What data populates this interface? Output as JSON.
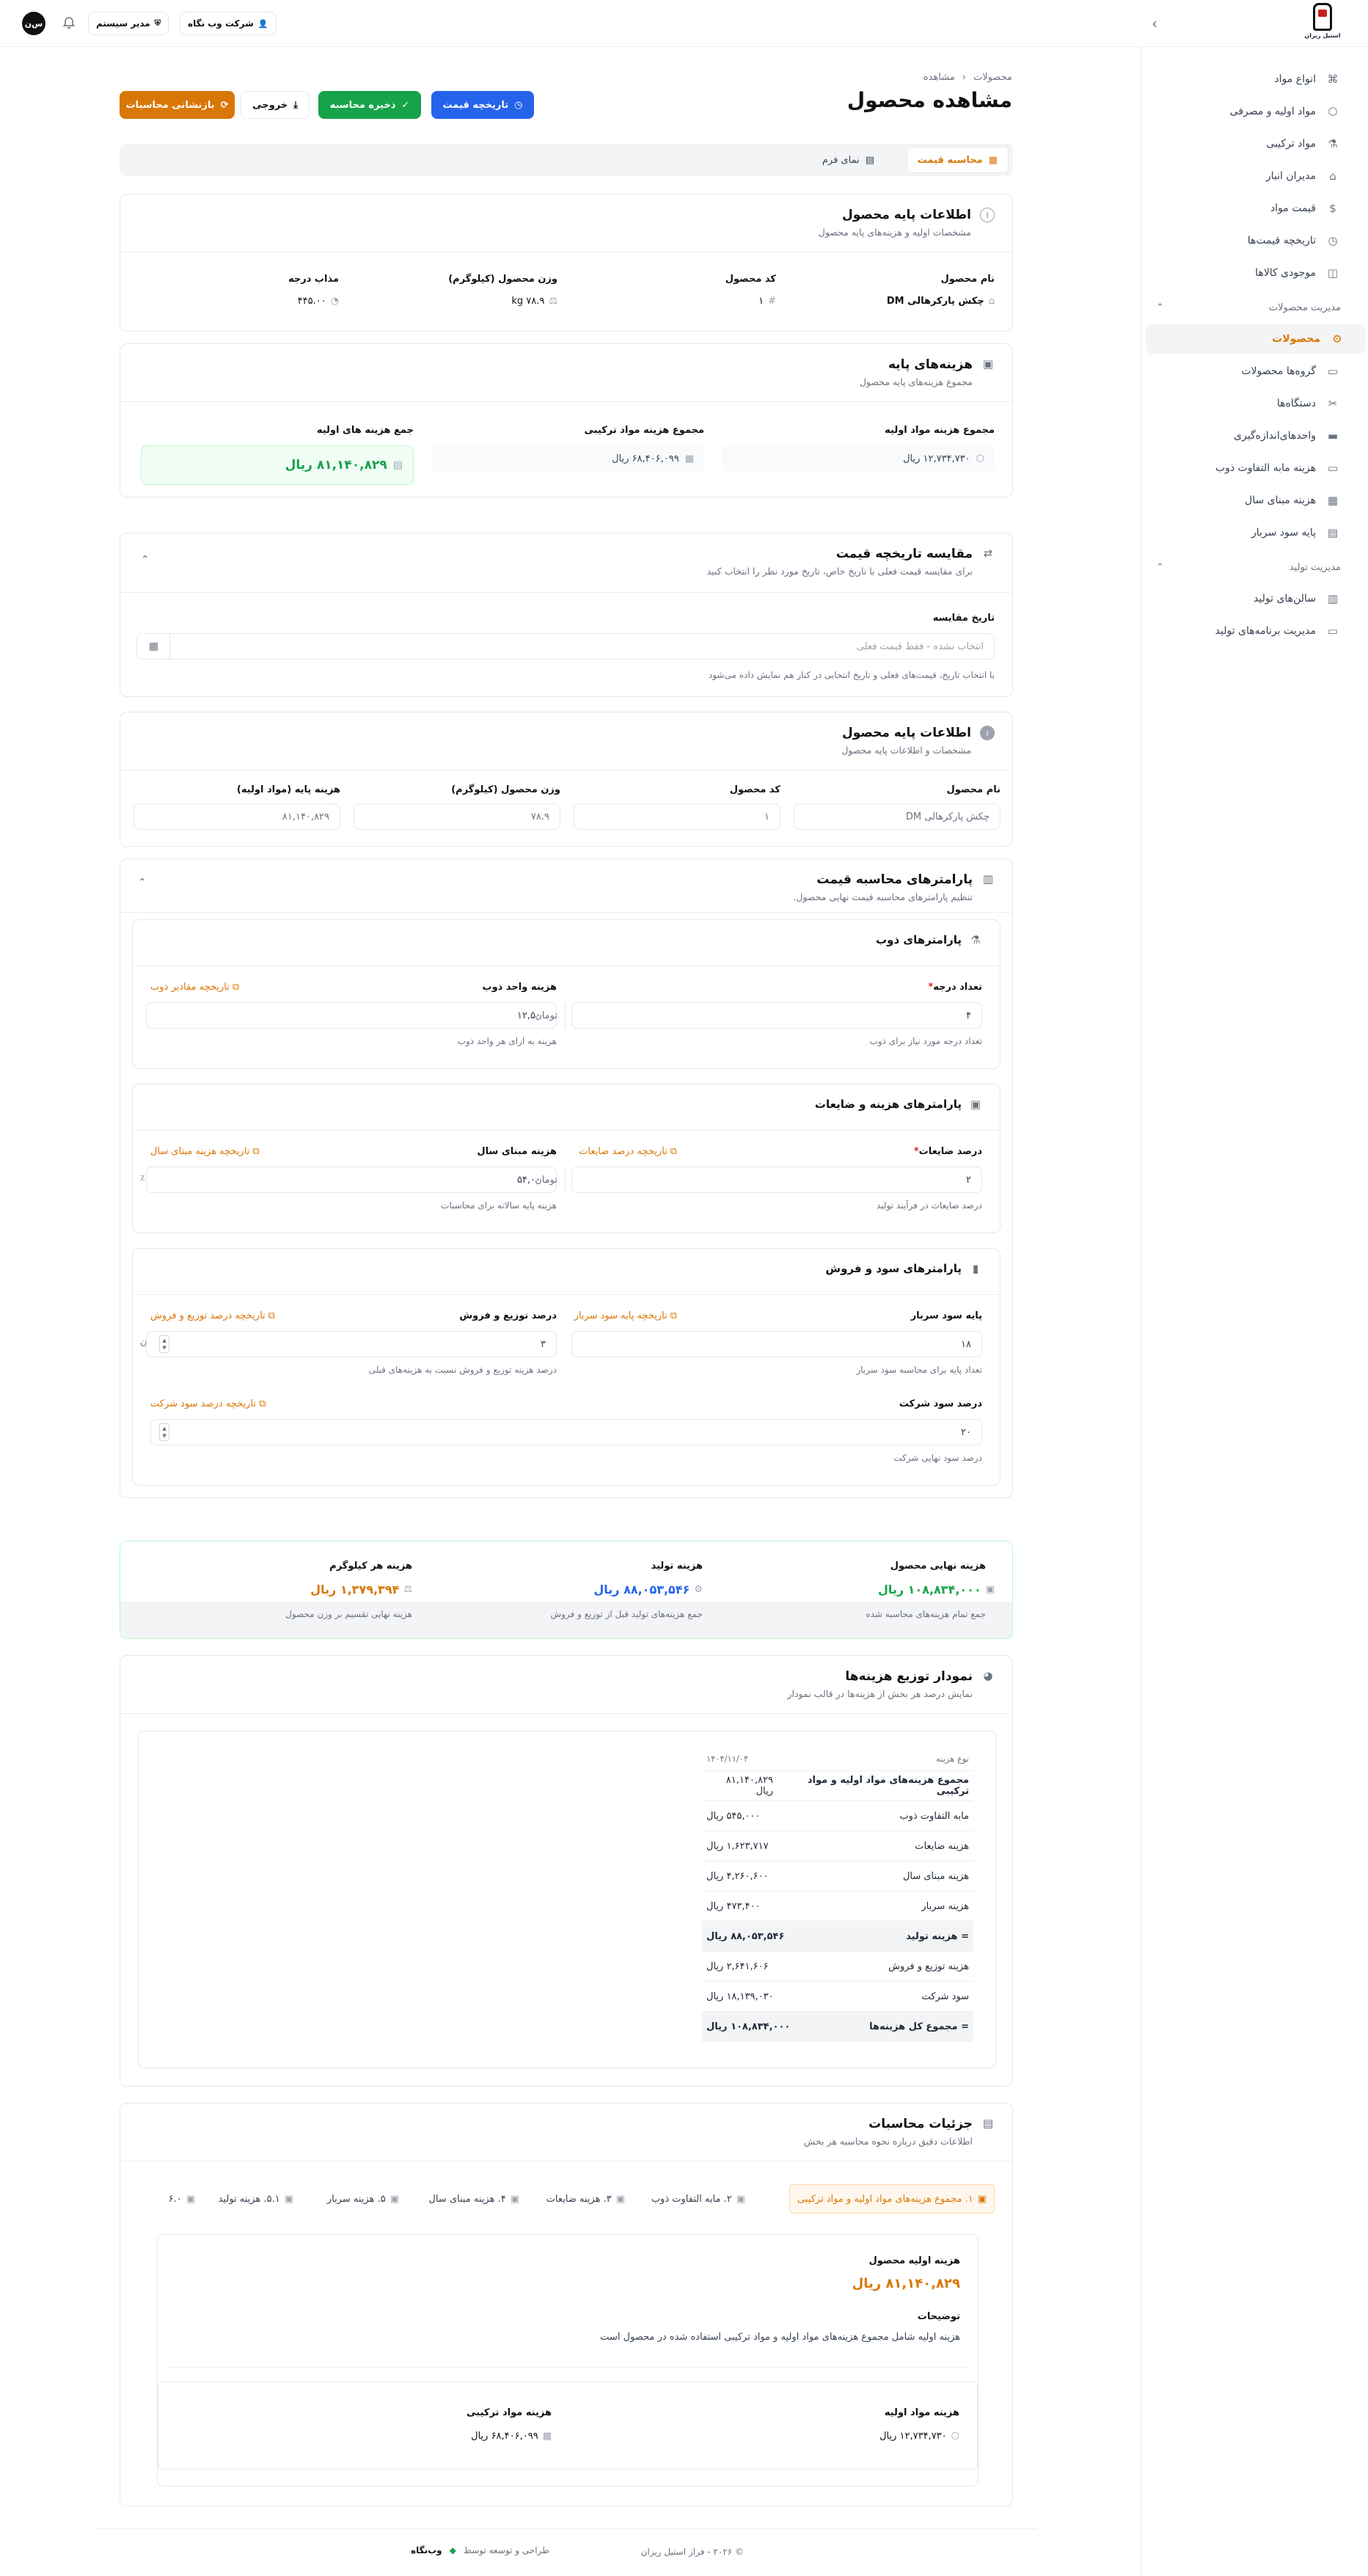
{
  "topbar": {
    "company": "شرکت وب نگاه",
    "user": "مدیر سیستم",
    "avatar": "س‌ن",
    "logo_text": "استیل ریزان"
  },
  "sidebar": {
    "items_top": [
      {
        "label": "انواع مواد",
        "icon": "tag-icon"
      },
      {
        "label": "مواد اولیه و مصرفی",
        "icon": "box-icon"
      },
      {
        "label": "مواد ترکیبی",
        "icon": "flask-icon"
      },
      {
        "label": "مدیران انبار",
        "icon": "warehouse-icon"
      },
      {
        "label": "قیمت مواد",
        "icon": "price-icon"
      },
      {
        "label": "تاریخچه قیمت‌ها",
        "icon": "history-icon"
      },
      {
        "label": "موجودی کالاها",
        "icon": "cube-icon"
      }
    ],
    "section_products": "مدیریت محصولات",
    "items_products": [
      {
        "label": "محصولات",
        "icon": "gear-icon",
        "active": true
      },
      {
        "label": "گروه‌ها محصولات",
        "icon": "folder-icon"
      },
      {
        "label": "دستگاه‌ها",
        "icon": "tools-icon"
      },
      {
        "label": "واحدهای‌اندازه‌گیری",
        "icon": "ruler-icon"
      },
      {
        "label": "هزینه مابه التفاوت ذوب",
        "icon": "fire-icon"
      },
      {
        "label": "هزینه مبنای سال",
        "icon": "calendar-icon"
      },
      {
        "label": "پایه سود سربار",
        "icon": "doc-icon"
      }
    ],
    "section_production": "مدیریت تولید",
    "items_production": [
      {
        "label": "سالن‌های تولید",
        "icon": "building-icon"
      },
      {
        "label": "مدیریت برنامه‌های تولید",
        "icon": "clipboard-icon"
      }
    ]
  },
  "page": {
    "breadcrumb_root": "محصولات",
    "breadcrumb_current": "مشاهده",
    "title": "مشاهده محصول",
    "btn_history": "تاریخچه قیمت",
    "btn_save": "ذخیره محاسبه",
    "btn_export": "خروجی",
    "btn_reset": "بازنشانی محاسبات",
    "tab_price": "محاسبه قیمت",
    "tab_form": "نمای فرم"
  },
  "base_info": {
    "title": "اطلاعات پایه محصول",
    "subtitle": "مشخصات اولیه و هزینه‌های پایه محصول",
    "name_label": "نام محصول",
    "name": "چکش پارکرهالی DM",
    "code_label": "کد محصول",
    "code": "۱",
    "weight_label": "وزن محصول (کیلوگرم)",
    "weight": "۷۸.۹ kg",
    "melt_label": "مذاب درجه",
    "melt": "۴۴۵.۰۰"
  },
  "base_costs": {
    "title": "هزینه‌های پایه",
    "subtitle": "مجموع هزینه‌های پایه محصول",
    "raw_label": "مجموع هزینه مواد اولیه",
    "raw": "۱۲,۷۳۴,۷۳۰ ریال",
    "comp_label": "مجموع هزینه مواد ترکیبی",
    "comp": "۶۸,۴۰۶,۰۹۹ ریال",
    "total_label": "جمع هزینه های اولیه",
    "total": "۸۱,۱۴۰,۸۲۹ ریال"
  },
  "compare": {
    "title": "مقایسه تاریخچه قیمت",
    "subtitle": "برای مقایسه قیمت فعلی با تاریخ خاص، تاریخ مورد نظر را انتخاب کنید",
    "date_label": "تاریخ مقایسه",
    "placeholder": "انتخاب نشده - فقط قیمت فعلی",
    "hint": "با انتخاب تاریخ، قیمت‌های فعلی و تاریخ انتخابی در کنار هم نمایش داده می‌شود"
  },
  "base_info2": {
    "title": "اطلاعات پایه محصول",
    "subtitle": "مشخصات و اطلاعات پایه محصول",
    "name_label": "نام محصول",
    "name": "چکش پارکرهالی DM",
    "code_label": "کد محصول",
    "code": "۱",
    "weight_label": "وزن محصول (کیلوگرم)",
    "weight": "۷۸.۹",
    "base_cost_label": "هزینه پایه (مواد اولیه)",
    "base_cost": "۸۱,۱۴۰,۸۲۹"
  },
  "params": {
    "title": "پارامترهای محاسبه قیمت",
    "subtitle": "تنظیم پارامترهای محاسبه قیمت نهایی محصول.",
    "melt": {
      "title": "پارامترهای ذوب",
      "count_label": "تعداد درجه",
      "count": "۴",
      "count_hint": "تعداد درجه مورد نیاز برای ذوب",
      "unit_cost_label": "هزینه واحد ذوب",
      "unit_cost": "۱۲,۵۰۰",
      "unit": "تومان",
      "unit_cost_hint": "هزینه به ازای هر واحد ذوب",
      "history_link": "تاریخچه مقادیر ذوب"
    },
    "waste": {
      "title": "پارامترهای هزینه و ضایعات",
      "pct_label": "درصد ضایعات",
      "pct": "۲",
      "pct_hint": "درصد ضایعات در فرآیند تولید",
      "pct_link": "تاریخچه درصد ضایعات",
      "year_label": "هزینه مبنای سال",
      "year": "۵۴,۰۰۰",
      "unit": "تومان",
      "year_hint": "هزینه پایه سالانه برای محاسبات",
      "year_link": "تاریخچه هزینه مبنای سال",
      "pct_sign": "٪"
    },
    "profit": {
      "title": "پارامترهای سود و فروش",
      "overhead_label": "پایه سود سربار",
      "overhead": "۱۸",
      "unit": "تومان",
      "overhead_hint": "تعداد پایه برای محاسبه سود سربار",
      "overhead_link": "تاریخچه پایه سود سربار",
      "dist_label": "درصد توزیع و فروش",
      "dist": "۳",
      "dist_hint": "درصد هزینه توزیع و فروش نسبت به هزینه‌های قبلی",
      "dist_link": "تاریخچه درصد توزیع و فروش",
      "company_label": "درصد سود شرکت",
      "company": "۲۰",
      "company_hint": "درصد سود نهایی شرکت",
      "company_link": "تاریخچه درصد سود شرکت",
      "pct_sign": "٪"
    }
  },
  "summary": {
    "final_label": "هزینه نهایی محصول",
    "final": "۱۰۸,۸۳۴,۰۰۰ ریال",
    "final_hint": "جمع تمام هزینه‌های محاسبه شده",
    "prod_label": "هزینه تولید",
    "prod": "۸۸,۰۵۳,۵۴۶ ریال",
    "prod_hint": "جمع هزینه‌های تولید قبل از توزیع و فروش",
    "kg_label": "هزینه هر کیلوگرم",
    "kg": "۱,۳۷۹,۳۹۴ ریال",
    "kg_hint": "هزینه نهایی تقسیم بر وزن محصول",
    "colors": {
      "final": "#16a34a",
      "prod": "#2563eb",
      "kg": "#d97706"
    }
  },
  "chart": {
    "title": "نمودار توزیع هزینه‌ها",
    "subtitle": "نمایش درصد هر بخش از هزینه‌ها در قالب نمودار",
    "col_type": "نوع هزینه",
    "col_date": "۱۴۰۴/۱۱/۰۴",
    "rows": [
      {
        "name": "مجموع هزینه‌های مواد اولیه و مواد ترکیبی",
        "value": "۸۱,۱۴۰,۸۲۹ ریال"
      },
      {
        "name": "مابه التفاوت ذوب",
        "value": "۵۴۵,۰۰۰ ریال"
      },
      {
        "name": "هزینه ضایعات",
        "value": "۱,۶۲۳,۷۱۷ ریال"
      },
      {
        "name": "هزینه مبنای سال",
        "value": "۴,۲۶۰,۶۰۰ ریال"
      },
      {
        "name": "هزینه سربار",
        "value": "۴۷۳,۴۰۰ ریال"
      },
      {
        "name": "= هزینه تولید",
        "value": "۸۸,۰۵۳,۵۴۶ ریال",
        "hl": true
      },
      {
        "name": "هزینه توزیع و فروش",
        "value": "۲,۶۴۱,۶۰۶ ریال"
      },
      {
        "name": "سود شرکت",
        "value": "۱۸,۱۳۹,۰۳۰ ریال"
      },
      {
        "name": "= مجموع کل هزینه‌ها",
        "value": "۱۰۸,۸۳۴,۰۰۰ ریال",
        "hl": true
      }
    ]
  },
  "details": {
    "title": "جزئیات محاسبات",
    "subtitle": "اطلاعات دقیق درباره نحوه محاسبه هر بخش",
    "tabs": [
      "۱. مجموع هزینه‌های مواد اولیه و مواد ترکیبی",
      "۲. مابه التفاوت ذوب",
      "۳. هزینه ضایعات",
      "۴. هزینه مبنای سال",
      "۵. هزینه سربار",
      "۵.۱. هزینه تولید",
      "۶.۰"
    ],
    "base_label": "هزینه اولیه محصول",
    "base_value": "۸۱,۱۴۰,۸۲۹ ریال",
    "desc_label": "توضیحات",
    "desc": "هزینه اولیه شامل مجموع هزینه‌های مواد اولیه و مواد ترکیبی استفاده شده در محصول است",
    "raw_label": "هزینه مواد اولیه",
    "raw_value": "۱۲,۷۳۴,۷۳۰ ریال",
    "comp_label": "هزینه مواد ترکیبی",
    "comp_value": "۶۸,۴۰۶,۰۹۹ ریال"
  },
  "footer": {
    "copy": "© ۲۰۲۶ - فراز استیل ریزان",
    "credit": "طراحی و توسعه توسط",
    "brand": "وب‌نگاه"
  }
}
